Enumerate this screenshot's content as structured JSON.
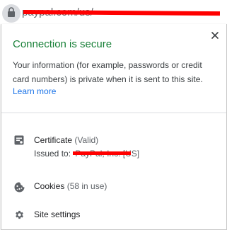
{
  "address_bar": {
    "url_text": "paypal.com/us/",
    "lock_icon": "lock-icon"
  },
  "popup": {
    "close_icon": "close-icon",
    "heading": "Connection is secure",
    "description": "Your information (for example, passwords or credit card numbers) is private when it is sent to this site.",
    "learn_more": "Learn more",
    "certificate": {
      "icon": "certificate-icon",
      "label": "Certificate",
      "status": "(Valid)",
      "issued_to_label": "Issued to:",
      "issued_to_value": "PayPal, Inc. [US]"
    },
    "cookies": {
      "icon": "cookie-icon",
      "label": "Cookies",
      "count": "(58 in use)"
    },
    "site_settings": {
      "icon": "gear-icon",
      "label": "Site settings"
    }
  },
  "colors": {
    "secure_green": "#188038",
    "link_blue": "#1a73e8",
    "redaction_red": "#ff0000",
    "icon_gray": "#5f6368"
  }
}
